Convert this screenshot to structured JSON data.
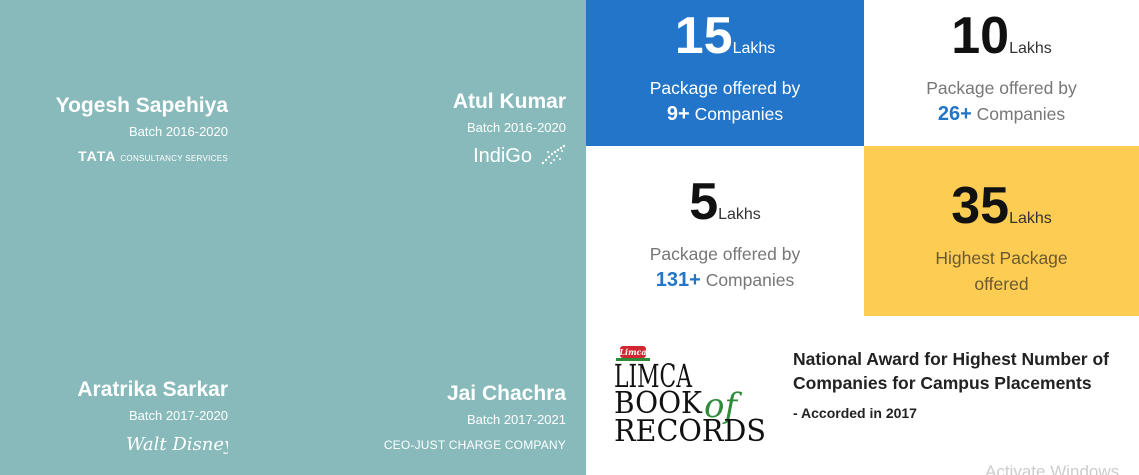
{
  "alumni": [
    {
      "name": "Yogesh Sapehiya",
      "batch": "Batch 2016-2020",
      "company_logo_main": "TATA",
      "company_logo_sub": "CONSULTANCY SERVICES"
    },
    {
      "name": "Atul Kumar",
      "batch": "Batch 2016-2020",
      "company_logo_main": "IndiGo"
    },
    {
      "name": "Aratrika Sarkar",
      "batch": "Batch 2017-2020",
      "company_logo_main": "Walt Disney"
    },
    {
      "name": "Jai Chachra",
      "batch": "Batch 2017-2021",
      "role": "CEO-JUST CHARGE COMPANY"
    }
  ],
  "stats": [
    {
      "value": "15",
      "unit": "Lakhs",
      "line1": "Package offered by",
      "count": "9+",
      "suffix": " Companies"
    },
    {
      "value": "10",
      "unit": "Lakhs",
      "line1": "Package offered by",
      "count": "26+",
      "suffix": " Companies"
    },
    {
      "value": "5",
      "unit": "Lakhs",
      "line1": "Package offered by",
      "count": "131+",
      "suffix": " Companies"
    },
    {
      "value": "35",
      "unit": "Lakhs",
      "line1": "Highest Package",
      "line2": "offered"
    }
  ],
  "award": {
    "logo_badge": "Limca",
    "logo_line1": "LIMCA",
    "logo_line2": "BOOK",
    "logo_of": "of",
    "logo_line3": "RECORDS",
    "title": "National Award for Highest Number of Companies for Campus Placements",
    "accorded": "- Accorded in 2017"
  },
  "watermark": "Activate Windows",
  "colors": {
    "teal": "#88babb",
    "blue": "#2275c8",
    "yellow": "#fdcc52",
    "green": "#2e8b3a",
    "red": "#d22630"
  }
}
